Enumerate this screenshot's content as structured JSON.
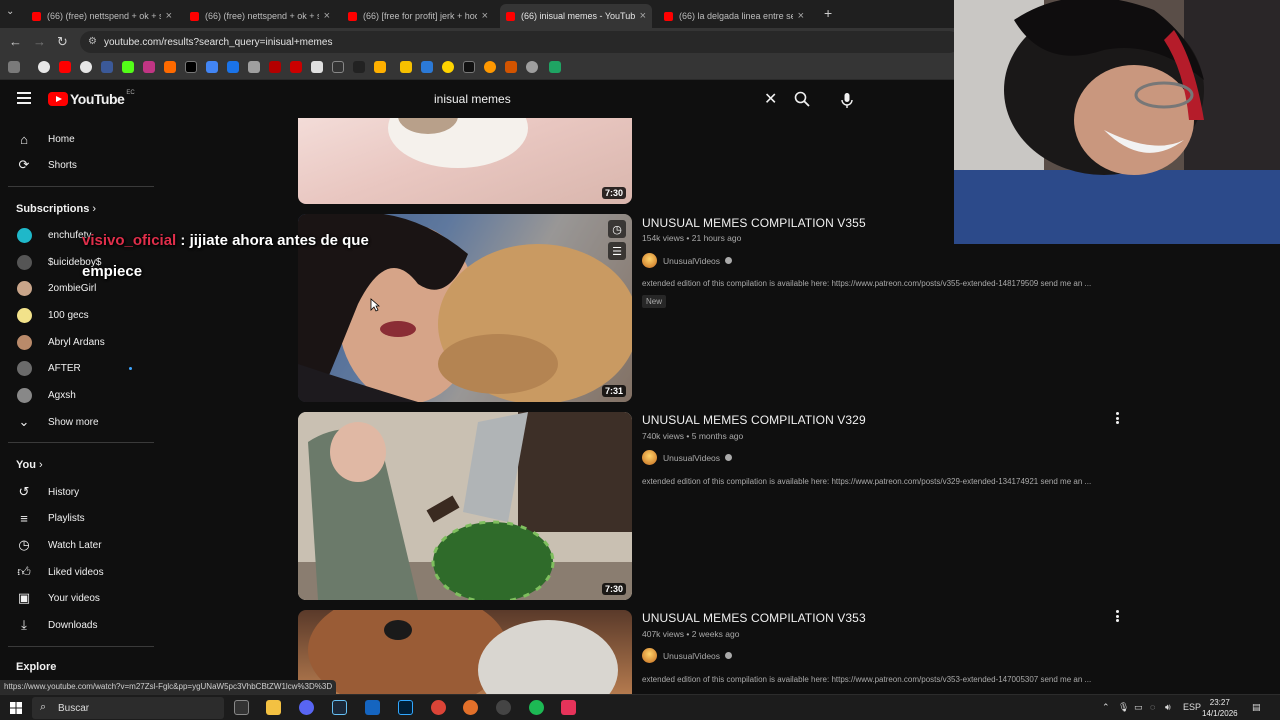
{
  "browser": {
    "tabs": [
      {
        "title": "(66) (free) nettspend + ok + sa",
        "active": false
      },
      {
        "title": "(66) (free) nettspend + ok + sa",
        "active": false
      },
      {
        "title": "(66) [free for profit] jerk + hoo",
        "active": false
      },
      {
        "title": "(66) inisual memes - YouTube",
        "active": true
      },
      {
        "title": "(66) la delgada linea entre ser s",
        "active": false
      }
    ],
    "url": "youtube.com/results?search_query=inisual+memes",
    "status_url": "https://www.youtube.com/watch?v=m27Zsl-Fglc&pp=ygUNaW5pc3VhbCBtZW1lcw%3D%3D"
  },
  "youtube": {
    "logo_text": "YouTube",
    "country_code": "EC",
    "search_query": "inisual memes"
  },
  "sidebar": {
    "main": [
      {
        "label": "Home",
        "icon": "home-icon"
      },
      {
        "label": "Shorts",
        "icon": "shorts-icon"
      }
    ],
    "subscriptions_heading": "Subscriptions",
    "subscriptions": [
      {
        "label": "enchufetv",
        "color": "#1fb8c9"
      },
      {
        "label": "$uicideboy$",
        "color": "#555555"
      },
      {
        "label": "2ombieGirl",
        "color": "#c9a58a"
      },
      {
        "label": "100 gecs",
        "color": "#f2e28a"
      },
      {
        "label": "Abryl Ardans",
        "color": "#b98a6a"
      },
      {
        "label": "AFTER",
        "color": "#6b6b6b",
        "new": true
      },
      {
        "label": "Agxsh",
        "color": "#888888"
      }
    ],
    "show_more": "Show more",
    "you_heading": "You",
    "you": [
      {
        "label": "History",
        "icon": "history-icon"
      },
      {
        "label": "Playlists",
        "icon": "playlists-icon"
      },
      {
        "label": "Watch Later",
        "icon": "watch-later-icon"
      },
      {
        "label": "Liked videos",
        "icon": "liked-videos-icon"
      },
      {
        "label": "Your videos",
        "icon": "your-videos-icon"
      },
      {
        "label": "Downloads",
        "icon": "downloads-icon"
      }
    ],
    "explore_heading": "Explore"
  },
  "results": [
    {
      "duration": "7:30"
    },
    {
      "title": "UNUSUAL MEMES COMPILATION V355",
      "meta": "154k views • 21 hours ago",
      "channel": "UnusualVideos",
      "description": "extended edition of this compilation is available here: https://www.patreon.com/posts/v355-extended-148179509 send me an ...",
      "badge": "New",
      "duration": "7:31"
    },
    {
      "title": "UNUSUAL MEMES COMPILATION V329",
      "meta": "740k views • 5 months ago",
      "channel": "UnusualVideos",
      "description": "extended edition of this compilation is available here: https://www.patreon.com/posts/v329-extended-134174921 send me an ...",
      "duration": "7:30"
    },
    {
      "title": "UNUSUAL MEMES COMPILATION V353",
      "meta": "407k views • 2 weeks ago",
      "channel": "UnusualVideos",
      "description": "extended edition of this compilation is available here: https://www.patreon.com/posts/v353-extended-147005307 send me an ..."
    }
  ],
  "chat_overlay": {
    "username": "visivo_oficial",
    "separator": ":",
    "message_line1": "jijiate ahora antes de que",
    "message_line2": "empiece"
  },
  "taskbar": {
    "search_placeholder": "Buscar",
    "language": "ESP",
    "time": "23:27",
    "date": "14/1/2026"
  },
  "colors": {
    "background": "#0f0f0f",
    "youtube_red": "#ff0000",
    "chat_username": "#e02f4b"
  }
}
